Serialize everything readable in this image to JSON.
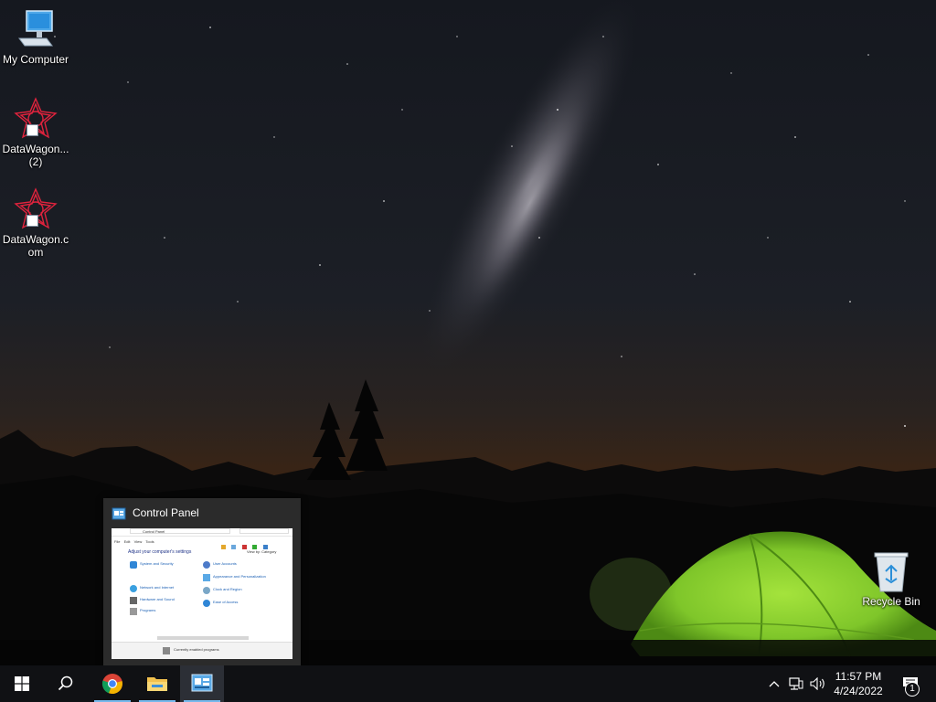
{
  "desktop": {
    "icons": [
      {
        "label": "My Computer",
        "icon": "monitor-icon"
      },
      {
        "label": "DataWagon...\n(2)",
        "icon": "datawagon-logo-icon",
        "shortcut": true
      },
      {
        "label": "DataWagon.c\nom",
        "icon": "datawagon-logo-icon",
        "shortcut": true
      },
      {
        "label": "Recycle Bin",
        "icon": "recycle-bin-icon"
      }
    ]
  },
  "preview": {
    "title": "Control Panel",
    "thumbnail": {
      "address": "Control Panel",
      "menu": [
        "File",
        "Edit",
        "View",
        "Tools"
      ],
      "heading": "Adjust your computer's settings",
      "view_by": "View by:  Category",
      "left_items": [
        "System and Security",
        "Network and Internet",
        "Hardware and Sound",
        "Programs"
      ],
      "right_items": [
        "User Accounts",
        "Appearance and Personalization",
        "Clock and Region",
        "Ease of Access"
      ],
      "status": "Currently enabled programs"
    }
  },
  "taskbar": {
    "buttons": [
      {
        "name": "start-button",
        "icon": "windows-logo-icon"
      },
      {
        "name": "search-button",
        "icon": "search-icon"
      },
      {
        "name": "chrome-button",
        "icon": "chrome-icon"
      },
      {
        "name": "file-explorer-button",
        "icon": "folder-icon"
      },
      {
        "name": "control-panel-button",
        "icon": "control-panel-icon",
        "active": true
      }
    ],
    "tray": {
      "time": "11:57 PM",
      "date": "4/24/2022",
      "notification_count": "1"
    }
  },
  "colors": {
    "taskbar": "#101114",
    "accent": "#76b9ed",
    "preview_bg": "#2b2b2b",
    "tent": "#8fd631"
  }
}
